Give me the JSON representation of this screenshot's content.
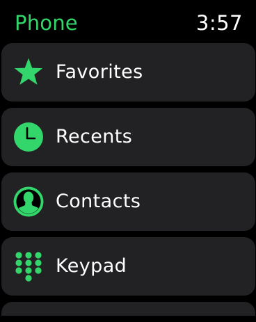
{
  "app": {
    "title": "Phone",
    "time": "3:57"
  },
  "colors": {
    "accent": "#33d66a",
    "background": "#000000",
    "card": "#222224",
    "text": "#ffffff"
  },
  "menu": {
    "items": [
      {
        "label": "Favorites",
        "icon": "star-icon"
      },
      {
        "label": "Recents",
        "icon": "clock-icon"
      },
      {
        "label": "Contacts",
        "icon": "person-icon"
      },
      {
        "label": "Keypad",
        "icon": "keypad-icon"
      }
    ]
  }
}
